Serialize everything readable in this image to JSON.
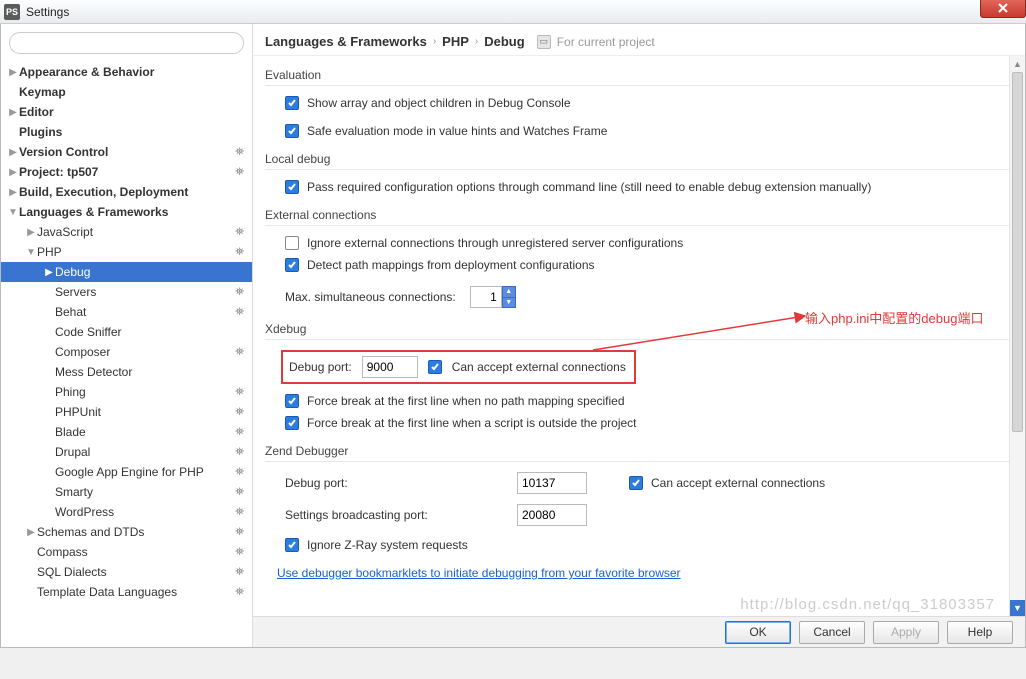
{
  "window": {
    "title": "Settings",
    "app_icon": "PS"
  },
  "search": {
    "placeholder": ""
  },
  "sidebar": {
    "items": [
      {
        "label": "Appearance & Behavior",
        "indent": 0,
        "bold": true,
        "arrow": "▶",
        "gear": false
      },
      {
        "label": "Keymap",
        "indent": 0,
        "bold": true,
        "arrow": "",
        "gear": false
      },
      {
        "label": "Editor",
        "indent": 0,
        "bold": true,
        "arrow": "▶",
        "gear": false
      },
      {
        "label": "Plugins",
        "indent": 0,
        "bold": true,
        "arrow": "",
        "gear": false
      },
      {
        "label": "Version Control",
        "indent": 0,
        "bold": true,
        "arrow": "▶",
        "gear": true
      },
      {
        "label": "Project: tp507",
        "indent": 0,
        "bold": true,
        "arrow": "▶",
        "gear": true
      },
      {
        "label": "Build, Execution, Deployment",
        "indent": 0,
        "bold": true,
        "arrow": "▶",
        "gear": false
      },
      {
        "label": "Languages & Frameworks",
        "indent": 0,
        "bold": true,
        "arrow": "▼",
        "gear": false
      },
      {
        "label": "JavaScript",
        "indent": 1,
        "bold": false,
        "arrow": "▶",
        "gear": true
      },
      {
        "label": "PHP",
        "indent": 1,
        "bold": false,
        "arrow": "▼",
        "gear": true
      },
      {
        "label": "Debug",
        "indent": 2,
        "bold": false,
        "arrow": "▶",
        "gear": false,
        "selected": true
      },
      {
        "label": "Servers",
        "indent": 2,
        "bold": false,
        "arrow": "",
        "gear": true
      },
      {
        "label": "Behat",
        "indent": 2,
        "bold": false,
        "arrow": "",
        "gear": true
      },
      {
        "label": "Code Sniffer",
        "indent": 2,
        "bold": false,
        "arrow": "",
        "gear": false
      },
      {
        "label": "Composer",
        "indent": 2,
        "bold": false,
        "arrow": "",
        "gear": true
      },
      {
        "label": "Mess Detector",
        "indent": 2,
        "bold": false,
        "arrow": "",
        "gear": false
      },
      {
        "label": "Phing",
        "indent": 2,
        "bold": false,
        "arrow": "",
        "gear": true
      },
      {
        "label": "PHPUnit",
        "indent": 2,
        "bold": false,
        "arrow": "",
        "gear": true
      },
      {
        "label": "Blade",
        "indent": 2,
        "bold": false,
        "arrow": "",
        "gear": true
      },
      {
        "label": "Drupal",
        "indent": 2,
        "bold": false,
        "arrow": "",
        "gear": true
      },
      {
        "label": "Google App Engine for PHP",
        "indent": 2,
        "bold": false,
        "arrow": "",
        "gear": true
      },
      {
        "label": "Smarty",
        "indent": 2,
        "bold": false,
        "arrow": "",
        "gear": true
      },
      {
        "label": "WordPress",
        "indent": 2,
        "bold": false,
        "arrow": "",
        "gear": true
      },
      {
        "label": "Schemas and DTDs",
        "indent": 1,
        "bold": false,
        "arrow": "▶",
        "gear": true
      },
      {
        "label": "Compass",
        "indent": 1,
        "bold": false,
        "arrow": "",
        "gear": true
      },
      {
        "label": "SQL Dialects",
        "indent": 1,
        "bold": false,
        "arrow": "",
        "gear": true
      },
      {
        "label": "Template Data Languages",
        "indent": 1,
        "bold": false,
        "arrow": "",
        "gear": true
      }
    ]
  },
  "breadcrumb": {
    "a": "Languages & Frameworks",
    "b": "PHP",
    "c": "Debug",
    "proj": "For current project"
  },
  "sections": {
    "evaluation": {
      "title": "Evaluation",
      "opt1": "Show array and object children in Debug Console",
      "opt2": "Safe evaluation mode in value hints and Watches Frame"
    },
    "local": {
      "title": "Local debug",
      "opt1": "Pass required configuration options through command line (still need to enable debug extension manually)"
    },
    "external": {
      "title": "External connections",
      "opt1": "Ignore external connections through unregistered server configurations",
      "opt2": "Detect path mappings from deployment configurations",
      "maxlabel": "Max. simultaneous connections:",
      "maxvalue": "1"
    },
    "xdebug": {
      "title": "Xdebug",
      "portlabel": "Debug port:",
      "portvalue": "9000",
      "accept": "Can accept external connections",
      "force1": "Force break at the first line when no path mapping specified",
      "force2": "Force break at the first line when a script is outside the project"
    },
    "zend": {
      "title": "Zend Debugger",
      "portlabel": "Debug port:",
      "portvalue": "10137",
      "accept": "Can accept external connections",
      "broadcastlabel": "Settings broadcasting port:",
      "broadcastvalue": "20080",
      "zray": "Ignore Z-Ray system requests"
    },
    "bookmark": "Use debugger bookmarklets to initiate debugging from your favorite browser"
  },
  "annotation": "输入php.ini中配置的debug端口",
  "buttons": {
    "ok": "OK",
    "cancel": "Cancel",
    "apply": "Apply",
    "help": "Help"
  },
  "watermark": "http://blog.csdn.net/qq_31803357"
}
